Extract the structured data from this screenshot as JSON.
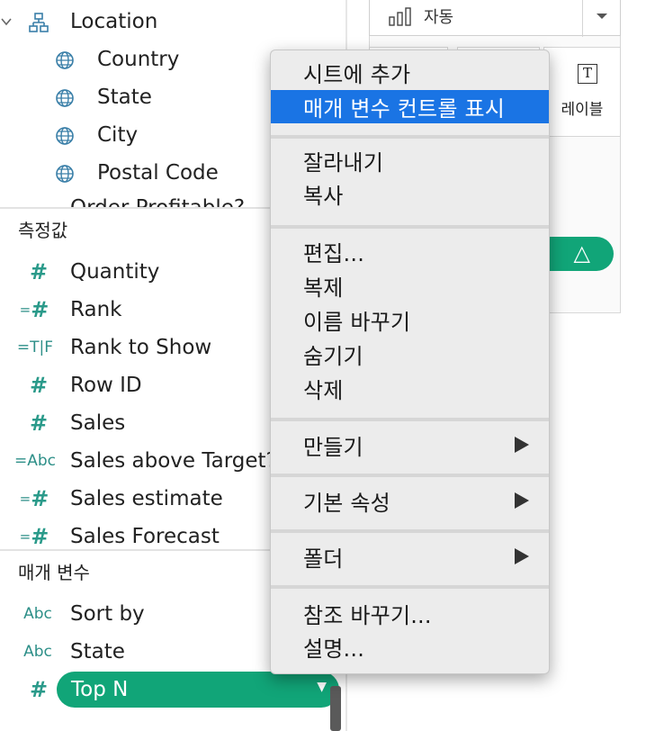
{
  "dimensions": {
    "items": [
      {
        "label": "Location",
        "icon": "hierarchy-icon"
      },
      {
        "label": "Country",
        "icon": "globe-icon"
      },
      {
        "label": "State",
        "icon": "globe-icon"
      },
      {
        "label": "City",
        "icon": "globe-icon"
      },
      {
        "label": "Postal Code",
        "icon": "globe-icon"
      }
    ],
    "cutoff_label": "Order Profitable?"
  },
  "measures": {
    "title": "측정값",
    "items": [
      {
        "label": "Quantity",
        "type": "#"
      },
      {
        "label": "Rank",
        "type": "=#"
      },
      {
        "label": "Rank to Show",
        "type": "=T|F"
      },
      {
        "label": "Row ID",
        "type": "#"
      },
      {
        "label": "Sales",
        "type": "#"
      },
      {
        "label": "Sales above Target?",
        "type": "=Abc"
      },
      {
        "label": "Sales estimate",
        "type": "=#"
      },
      {
        "label": "Sales Forecast",
        "type": "=#"
      }
    ]
  },
  "parameters": {
    "title": "매개 변수",
    "items": [
      {
        "label": "Sort by",
        "type": "Abc"
      },
      {
        "label": "State",
        "type": "Abc"
      },
      {
        "label": "Top N",
        "type": "#",
        "selected": true
      }
    ]
  },
  "marks_card": {
    "mark_type": "자동",
    "label_button": "레이블",
    "label_icon_text": "T",
    "delta_glyph": "△"
  },
  "context_menu": {
    "items": [
      {
        "label": "시트에 추가"
      },
      {
        "label": "매개 변수 컨트롤 표시",
        "selected": true
      },
      {
        "label": "잘라내기"
      },
      {
        "label": "복사"
      },
      {
        "label": "편집..."
      },
      {
        "label": "복제"
      },
      {
        "label": "이름 바꾸기"
      },
      {
        "label": "숨기기"
      },
      {
        "label": "삭제"
      },
      {
        "label": "만들기",
        "submenu": true
      },
      {
        "label": "기본 속성",
        "submenu": true
      },
      {
        "label": "폴더",
        "submenu": true
      },
      {
        "label": "참조 바꾸기..."
      },
      {
        "label": "설명..."
      }
    ]
  },
  "colors": {
    "pill_green": "#11a578",
    "menu_selection": "#1a74e4",
    "field_icon": "#2a9a8a"
  }
}
